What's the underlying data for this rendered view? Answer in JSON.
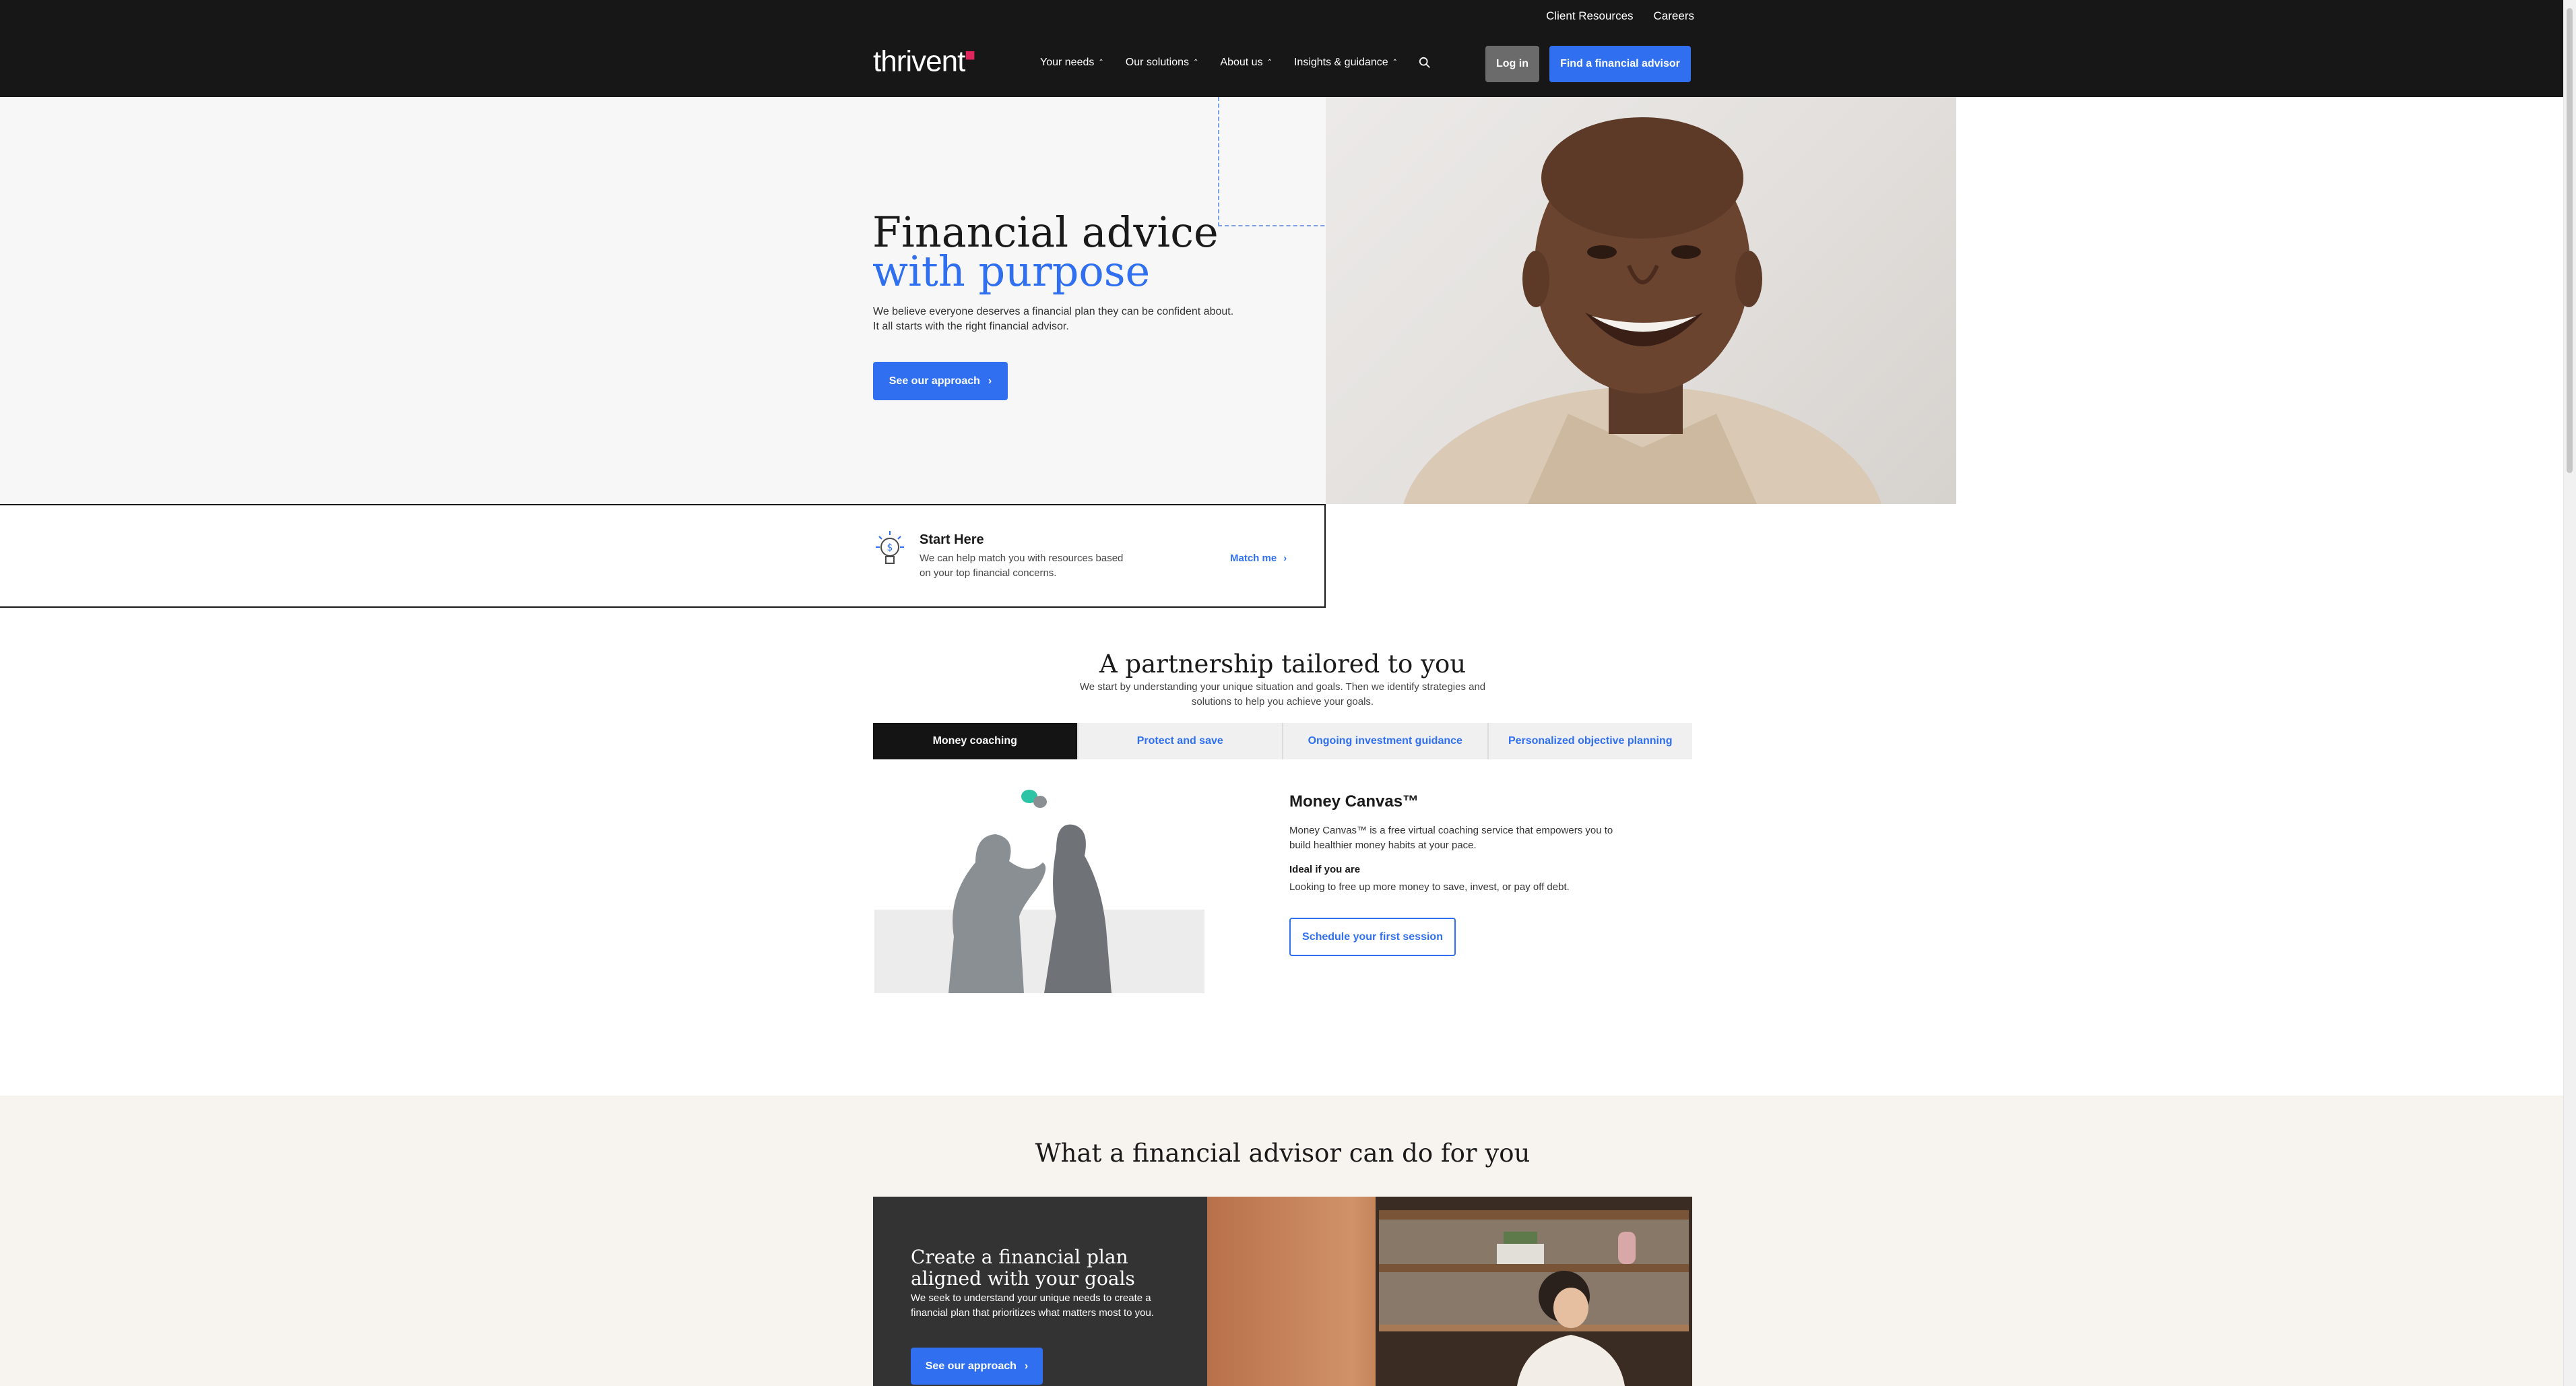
{
  "header": {
    "utility_links": [
      "Client Resources",
      "Careers"
    ],
    "logo_text": "thrivent",
    "nav": [
      {
        "label": "Your needs"
      },
      {
        "label": "Our solutions"
      },
      {
        "label": "About us"
      },
      {
        "label": "Insights & guidance"
      }
    ],
    "login_label": "Log in",
    "find_advisor_label": "Find a financial advisor"
  },
  "hero": {
    "title_line1": "Financial advice",
    "title_line2": "with purpose",
    "subtitle_line1": "We believe everyone deserves a financial plan they can be confident about.",
    "subtitle_line2": "It all starts with the right financial advisor.",
    "cta_label": "See our approach"
  },
  "start_here": {
    "title": "Start Here",
    "description": "We can help match you with resources based on your top financial concerns.",
    "link_label": "Match me"
  },
  "partnership": {
    "title": "A partnership tailored to you",
    "subtitle": "We start by understanding your unique situation and goals. Then we identify strategies and solutions to help you achieve your goals.",
    "tabs": [
      "Money coaching",
      "Protect and save",
      "Ongoing investment guidance",
      "Personalized objective planning"
    ],
    "active_tab": "Money coaching",
    "panel": {
      "title": "Money Canvas™",
      "description": "Money Canvas™ is a free virtual coaching service that empowers you to build healthier money habits at your pace.",
      "ideal_label": "Ideal if you are",
      "ideal_text": "Looking to free up more money to save, invest, or pay off debt.",
      "cta_label": "Schedule your first session"
    }
  },
  "advisor_section": {
    "title": "What a financial advisor can do for you",
    "card_title": "Create a financial plan aligned with your goals",
    "card_desc": "We seek to understand your unique needs to create a financial plan that prioritizes what matters most to you.",
    "cta_label": "See our approach"
  },
  "colors": {
    "header_bg": "#171717",
    "accent_blue": "#2f6ff0",
    "logo_dot": "#e0245e",
    "section_beige": "#f7f3ee"
  }
}
